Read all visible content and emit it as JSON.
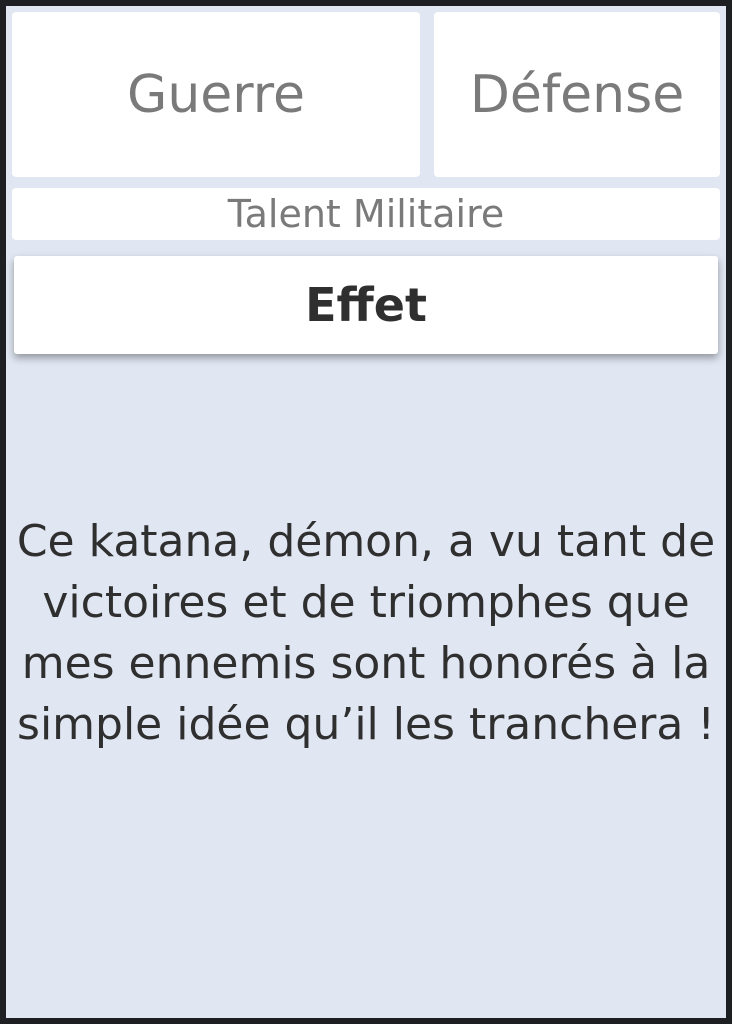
{
  "tabs": {
    "guerre_label": "Guerre",
    "defense_label": "Défense"
  },
  "category": {
    "label": "Talent Militaire"
  },
  "effect": {
    "header": "Effet",
    "description": "Ce katana, démon, a vu tant de victoires et de triomphes que mes ennemis sont honorés à la simple idée qu’il les tranchera !"
  },
  "colors": {
    "background": "#e0e6f2",
    "card": "#ffffff",
    "muted_text": "#7a7a7a",
    "dark_text": "#2f2f2f",
    "outer_frame": "#1e1f22"
  }
}
